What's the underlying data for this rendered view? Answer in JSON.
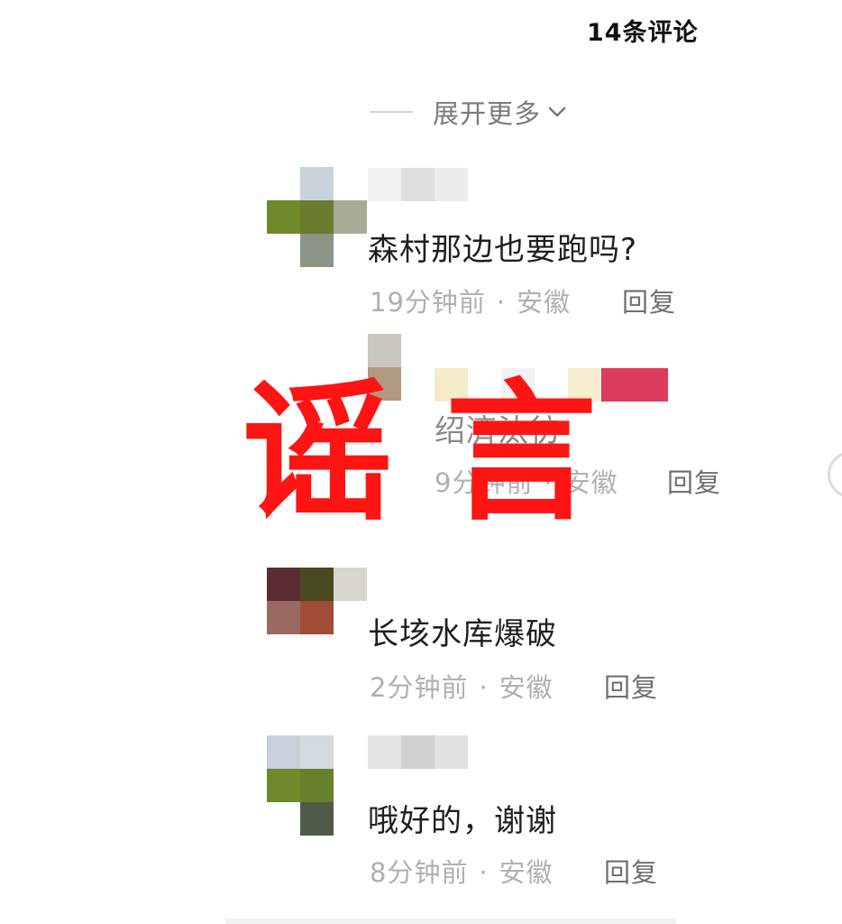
{
  "header": {
    "comment_count_label": "14条评论"
  },
  "expand": {
    "label": "展开更多"
  },
  "comments": [
    {
      "text": "森村那边也要跑吗?",
      "time": "19分钟前",
      "location": "安徽",
      "reply_label": "回复"
    },
    {
      "text": "绍濟汰彷",
      "time": "9分钟前",
      "location": "安徽",
      "reply_label": "回复"
    },
    {
      "text": "长垓水库爆破",
      "time": "2分钟前",
      "location": "安徽",
      "reply_label": "回复"
    },
    {
      "text": "哦好的，谢谢",
      "time": "8分钟前",
      "location": "安徽",
      "reply_label": "回复"
    }
  ],
  "overlay": {
    "stamp_text": "谣言",
    "stamp_color": "#ff1414"
  },
  "colors": {
    "meta_gray": "#b0b0b0",
    "reply_gray": "#6f6f6f",
    "divider": "#d2d2d2"
  }
}
